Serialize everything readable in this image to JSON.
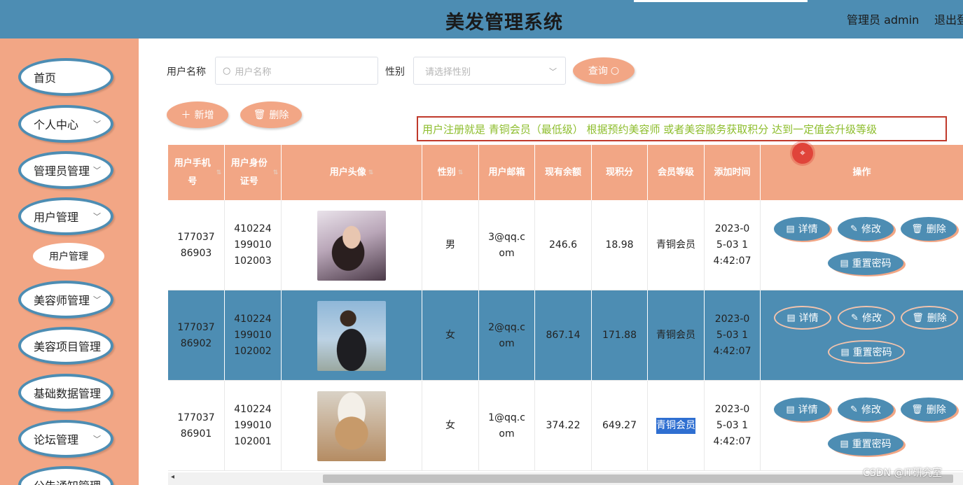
{
  "header": {
    "title": "美发管理系统",
    "user": "管理员 admin",
    "logout": "退出登"
  },
  "sidebar": {
    "items": [
      {
        "label": "首页",
        "has_children": false
      },
      {
        "label": "个人中心",
        "has_children": true
      },
      {
        "label": "管理员管理",
        "has_children": true
      },
      {
        "label": "用户管理",
        "has_children": true,
        "expanded": true
      },
      {
        "label": "美容师管理",
        "has_children": true
      },
      {
        "label": "美容项目管理",
        "has_children": true
      },
      {
        "label": "基础数据管理",
        "has_children": true
      },
      {
        "label": "论坛管理",
        "has_children": true
      },
      {
        "label": "公告通知管理",
        "has_children": true
      }
    ],
    "sub_item": "用户管理"
  },
  "search": {
    "name_label": "用户名称",
    "name_placeholder": "用户名称",
    "gender_label": "性别",
    "gender_placeholder": "请选择性别",
    "query_label": "查询"
  },
  "actions": {
    "add_label": "新增",
    "delete_label": "删除"
  },
  "notice": "用户注册就是 青铜会员（最低级） 根据预约美容师 或者美容服务获取积分 达到一定值会升级等级",
  "table": {
    "headers": [
      "用户手机号",
      "用户身份证号",
      "用户头像",
      "性别",
      "用户邮箱",
      "现有余额",
      "现积分",
      "会员等级",
      "添加时间",
      "操作"
    ],
    "rows": [
      {
        "phone": "17703786903",
        "id_card": "410224199010102003",
        "gender": "男",
        "email": "3@qq.com",
        "balance": "246.6",
        "points": "18.98",
        "level": "青铜会员",
        "added": "2023-05-03 14:42:07"
      },
      {
        "phone": "17703786902",
        "id_card": "410224199010102002",
        "gender": "女",
        "email": "2@qq.com",
        "balance": "867.14",
        "points": "171.88",
        "level": "青铜会员",
        "added": "2023-05-03 14:42:07"
      },
      {
        "phone": "17703786901",
        "id_card": "410224199010102001",
        "gender": "女",
        "email": "1@qq.com",
        "balance": "374.22",
        "points": "649.27",
        "level": "青铜会员",
        "added": "2023-05-03 14:42:07"
      }
    ],
    "row_buttons": {
      "detail": "详情",
      "edit": "修改",
      "delete": "删除",
      "reset_password": "重置密码"
    }
  },
  "watermark": "CSDN @IT研究室",
  "colors": {
    "header_blue": "#4d8db3",
    "accent_salmon": "#f2a685",
    "notice_text": "#8dbd2c",
    "notice_border": "#c0392b"
  }
}
